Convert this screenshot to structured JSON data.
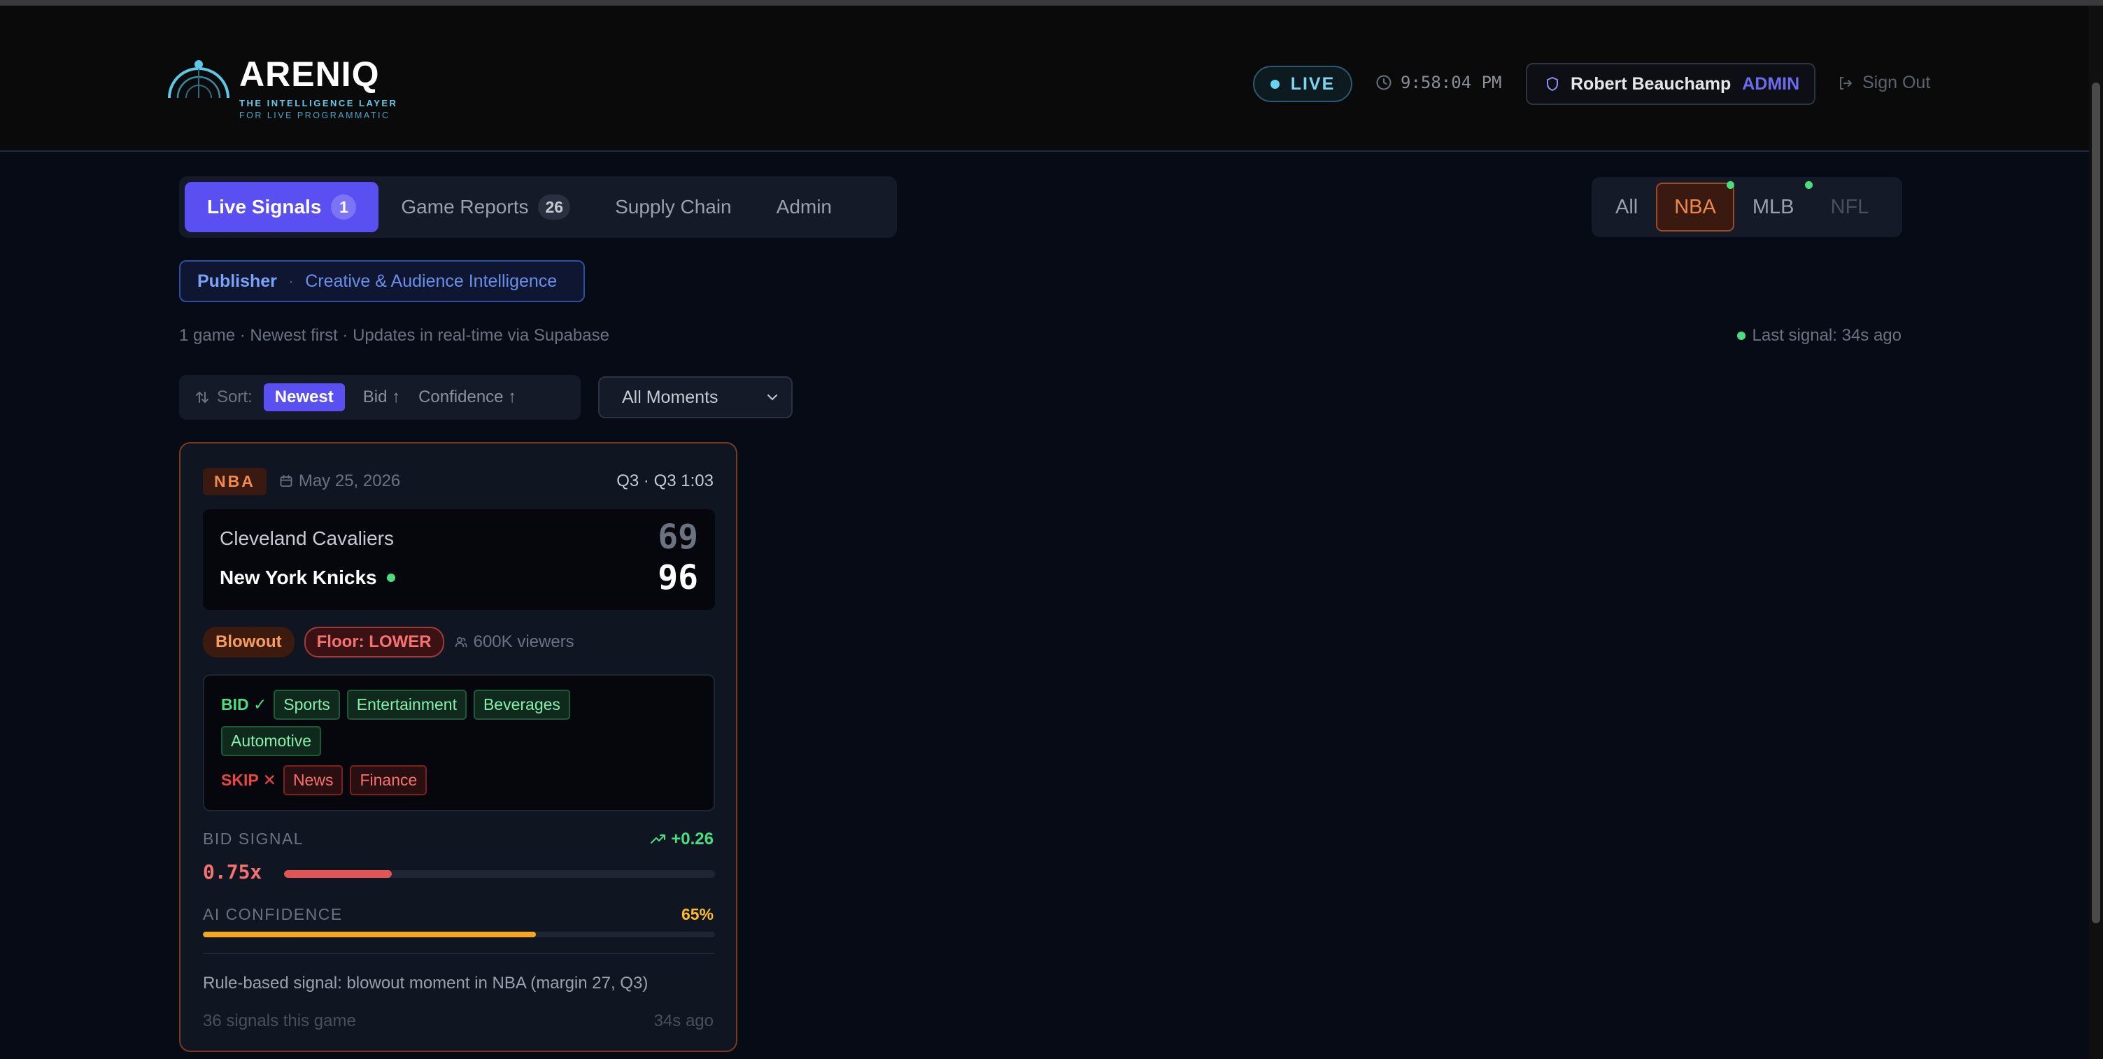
{
  "brand": {
    "name": "ARENIQ",
    "tagline_1": "THE INTELLIGENCE LAYER",
    "tagline_2": "FOR LIVE PROGRAMMATIC",
    "logo_icon": "radar-arc-icon"
  },
  "header": {
    "live_label": "LIVE",
    "time": "9:58:04 PM",
    "user_name": "Robert Beauchamp",
    "user_role": "ADMIN",
    "sign_out": "Sign Out"
  },
  "tabs": [
    {
      "label": "Live Signals",
      "count": "1",
      "active": true
    },
    {
      "label": "Game Reports",
      "count": "26",
      "active": false
    },
    {
      "label": "Supply Chain",
      "active": false
    },
    {
      "label": "Admin",
      "active": false
    }
  ],
  "leagues": [
    {
      "label": "All",
      "active": false,
      "live": false
    },
    {
      "label": "NBA",
      "active": true,
      "live": true
    },
    {
      "label": "MLB",
      "active": false,
      "live": true
    },
    {
      "label": "NFL",
      "active": false,
      "live": false
    }
  ],
  "role": {
    "primary": "Publisher",
    "separator": "·",
    "secondary": "Creative & Audience Intelligence"
  },
  "meta_text": "1 game · Newest first · Updates in real-time via Supabase",
  "last_signal": "Last signal: 34s ago",
  "sort": {
    "label": "Sort:",
    "options": [
      "Newest",
      "Bid ↑",
      "Confidence ↑"
    ],
    "active": "Newest"
  },
  "moments_select": "All Moments",
  "card": {
    "league": "NBA",
    "date": "May 25, 2026",
    "period": "Q3 · Q3 1:03",
    "away_team": "Cleveland Cavaliers",
    "away_score": "69",
    "home_team": "New York Knicks",
    "home_score": "96",
    "tag_moment": "Blowout",
    "tag_floor": "Floor: LOWER",
    "viewers": "600K viewers",
    "bid_label": "BID ✓",
    "bid_categories": [
      "Sports",
      "Entertainment",
      "Beverages",
      "Automotive"
    ],
    "skip_label": "SKIP ✕",
    "skip_categories": [
      "News",
      "Finance"
    ],
    "bid_signal_label": "BID SIGNAL",
    "bid_delta": "+0.26",
    "bid_signal_value": "0.75x",
    "bid_signal_fraction": 0.25,
    "confidence_label": "AI CONFIDENCE",
    "confidence_value": "65%",
    "confidence_fraction": 0.65,
    "note": "Rule-based signal: blowout moment in NBA (margin 27, Q3)",
    "signals_count": "36 signals this game",
    "ago": "34s ago"
  },
  "colors": {
    "accent": "#5a4ff0",
    "nba": "#f08a4a",
    "bid_green": "#4ade80",
    "skip_red": "#ef4444",
    "confidence": "#fbbf24"
  }
}
